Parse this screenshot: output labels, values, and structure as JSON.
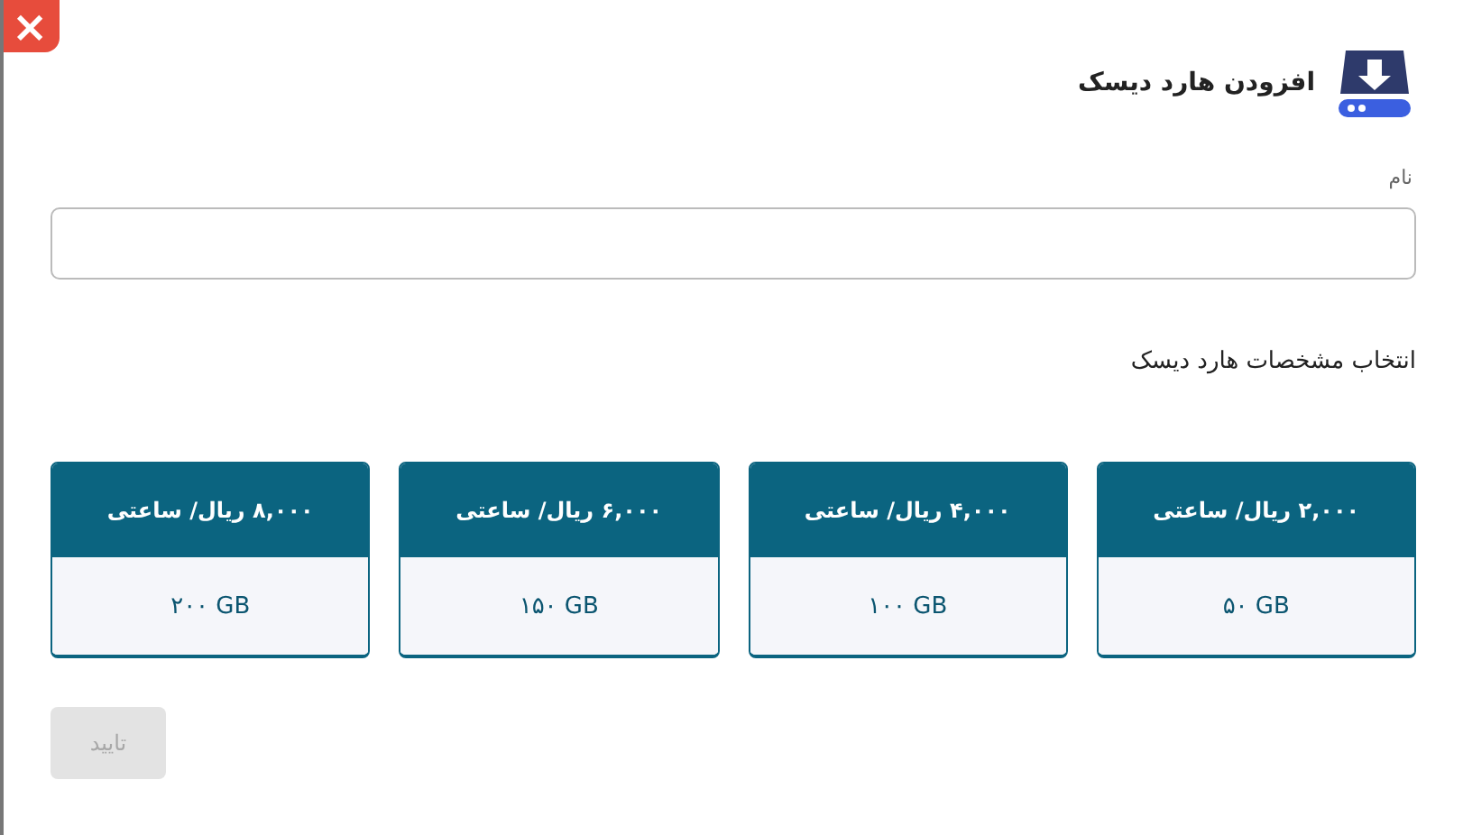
{
  "dialog": {
    "title": "افزودن هارد دیسک",
    "close": "×"
  },
  "name_field": {
    "label": "نام"
  },
  "section_title": "انتخاب مشخصات هارد دیسک",
  "plans": [
    {
      "price": "۲,۰۰۰ ریال/ ساعتی",
      "size": "۵۰ GB",
      "selected": false
    },
    {
      "price": "۴,۰۰۰ ریال/ ساعتی",
      "size": "۱۰۰ GB",
      "selected": false
    },
    {
      "price": "۶,۰۰۰ ریال/ ساعتی",
      "size": "۱۵۰ GB",
      "selected": false
    },
    {
      "price": "۸,۰۰۰ ریال/ ساعتی",
      "size": "۲۰۰ GB",
      "selected": false
    }
  ],
  "confirm_button": {
    "label": "تایید",
    "disabled": true
  }
}
